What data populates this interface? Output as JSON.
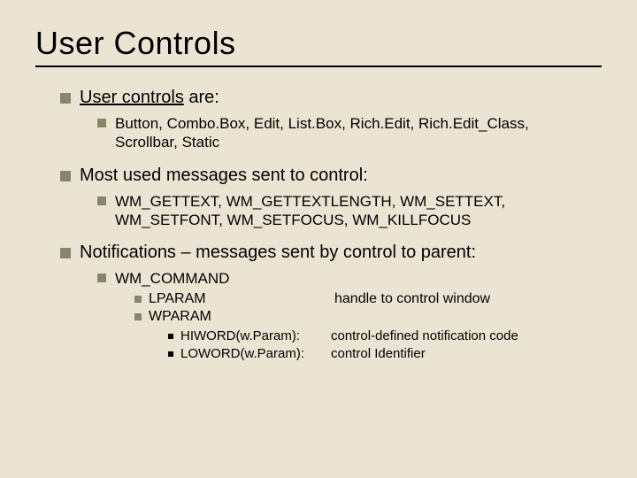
{
  "title": "User Controls",
  "p1": {
    "lead_underlined": "User controls",
    "lead_rest": " are:",
    "sub": "Button, Combo.Box, Edit, List.Box, Rich.Edit, Rich.Edit_Class, Scrollbar, Static"
  },
  "p2": {
    "lead": "Most used messages sent to control:",
    "sub": "WM_GETTEXT, WM_GETTEXTLENGTH, WM_SETTEXT, WM_SETFONT, WM_SETFOCUS, WM_KILLFOCUS"
  },
  "p3": {
    "lead": "Notifications – messages sent by control to parent:",
    "wmcommand": "WM_COMMAND",
    "lparam": {
      "label": "LPARAM",
      "desc": "handle to control window"
    },
    "wparam": {
      "label": "WPARAM"
    },
    "hiword": {
      "k": "HIWORD(w.Param):",
      "v": "control-defined notification code"
    },
    "loword": {
      "k": "LOWORD(w.Param):",
      "v": "control Identifier"
    }
  }
}
